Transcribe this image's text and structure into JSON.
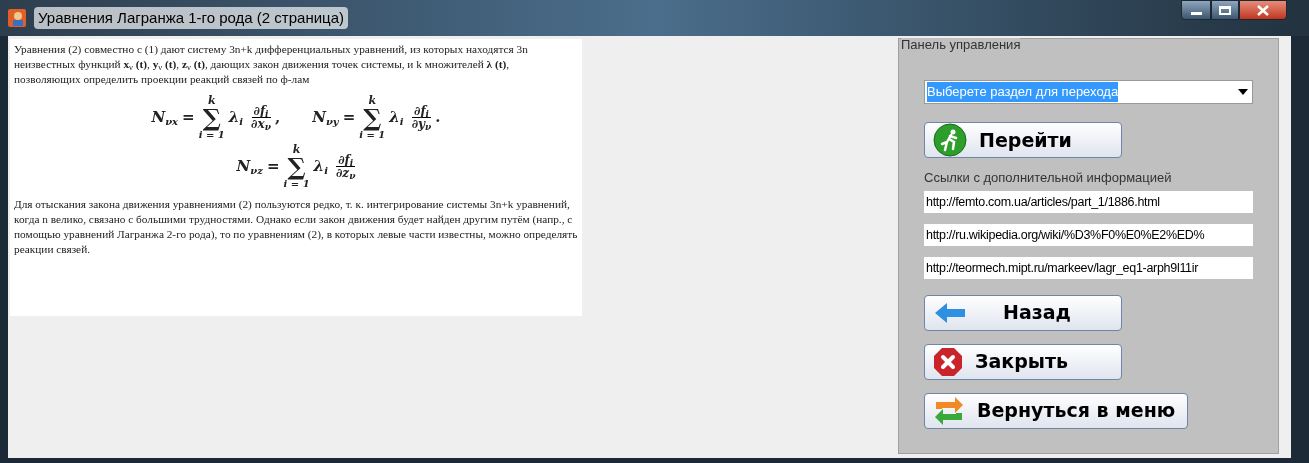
{
  "window": {
    "title": "Уравнения Лагранжа 1-го рода (2 страница)",
    "controls": [
      {
        "kind": "minimize"
      },
      {
        "kind": "maximize"
      },
      {
        "kind": "close"
      }
    ]
  },
  "document": {
    "paragraphs_before": [
      "Уравнения (2) совместно с (1) дают систему 3n+k дифференциальных уравнений, из которых находятся 3n неизвестных функций **x**$_{ν}$ **(t)**, **y**$_{ν}$ **(t)**, **z**$_{ν}$ **(t)**, дающих закон движения точек системы, и k множителей **λ (t)**, позволяющих определить проекции реакций связей по ф-лам"
    ],
    "formula_rows": [
      [
        {
          "lhs": "N",
          "lhs_sub": "νx",
          "equals": "=",
          "sum_top": "k",
          "sum_sign": "∑",
          "sum_bottom": "i = 1",
          "factor": "λ",
          "factor_sub": "i",
          "numerator": "∂f",
          "numerator_sub": "i",
          "denominator": "∂x",
          "denominator_sub": "ν",
          "trail": ","
        },
        {
          "lhs": "N",
          "lhs_sub": "νy",
          "equals": "=",
          "sum_top": "k",
          "sum_sign": "∑",
          "sum_bottom": "i = 1",
          "factor": "λ",
          "factor_sub": "i",
          "numerator": "∂f",
          "numerator_sub": "i",
          "denominator": "∂y",
          "denominator_sub": "ν",
          "trail": "."
        }
      ],
      [
        {
          "lhs": "N",
          "lhs_sub": "νz",
          "equals": "=",
          "sum_top": "k",
          "sum_sign": "∑",
          "sum_bottom": "i = 1",
          "factor": "λ",
          "factor_sub": "i",
          "numerator": "∂f",
          "numerator_sub": "i",
          "denominator": "∂z",
          "denominator_sub": "ν"
        }
      ]
    ],
    "paragraphs_after": [
      "Для отыскания закона движения уравнениями (2) пользуются редко, т. к. интегрирование системы 3n+k уравнений, когда n велико, связано с большими трудностями. Однако если закон движения будет найден другим путём (напр., с помощью уравнений Лагранжа 2-го рода), то по уравнениям (2), в которых левые части известны, можно определять реакции связей."
    ]
  },
  "panel": {
    "title": "Панель управления",
    "section_select": {
      "value": "Выберете раздел для перехода",
      "selected": true
    },
    "go_button": {
      "label": "Перейти"
    },
    "links_label": "Ссылки с дополнительной информацией",
    "links": [
      "http://femto.com.ua/articles/part_1/1886.html",
      "http://ru.wikipedia.org/wiki/%D3%F0%E0%E2%ED%",
      "http://teormech.mipt.ru/markeev/lagr_eq1-arph9l11ir"
    ],
    "buttons": [
      {
        "label": "Назад",
        "kind": "back"
      },
      {
        "label": "Закрыть",
        "kind": "close"
      },
      {
        "label": "Вернуться в меню",
        "kind": "menu"
      }
    ]
  }
}
